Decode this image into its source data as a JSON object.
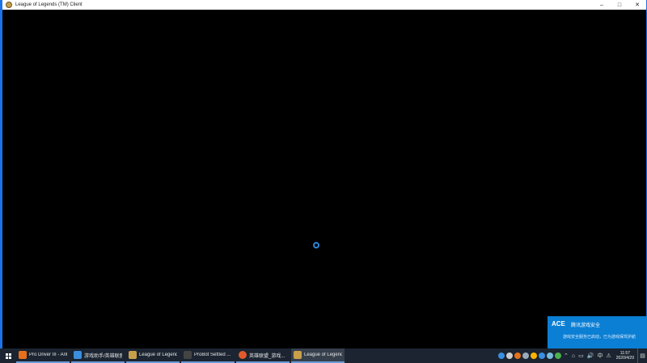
{
  "window": {
    "title": "League of Legends (TM) Client",
    "minimize_glyph": "–",
    "maximize_glyph": "□",
    "close_glyph": "✕"
  },
  "taskbar": {
    "items": [
      {
        "label": "Pro Driver III - Ant...",
        "icon_color": "#e8701a"
      },
      {
        "label": "游戏助手/英雄联盟...",
        "icon_color": "#3a8fe0"
      },
      {
        "label": "League of Legends",
        "icon_color": "#c8a04a"
      },
      {
        "label": "ProBot Settled ...",
        "icon_color": "#444444"
      },
      {
        "label": "英雄联盟_游戏...",
        "icon_color": "#e25a2a"
      },
      {
        "label": "League of Legends",
        "icon_color": "#c8a04a"
      }
    ],
    "tray": {
      "icons": [
        "#3a8fe0",
        "#cccccc",
        "#e8701a",
        "#9ab",
        "#ffb300",
        "#3a8fe0",
        "#7bd",
        "#4caf50"
      ],
      "glyphs": [
        "⌃",
        "⌂",
        "▭",
        "🔊",
        "中",
        "⚠"
      ],
      "time": "11:57",
      "date": "2020/4/29",
      "notification_glyph": "▤"
    }
  },
  "toast": {
    "brand": "ACE",
    "title": "腾讯游戏安全",
    "message": "游戏安全服务已启动，已为游戏保驾护航"
  },
  "colors": {
    "accent": "#1a73e8",
    "spinner": "#2b86d9",
    "toast_bg": "#0b7fd4"
  }
}
